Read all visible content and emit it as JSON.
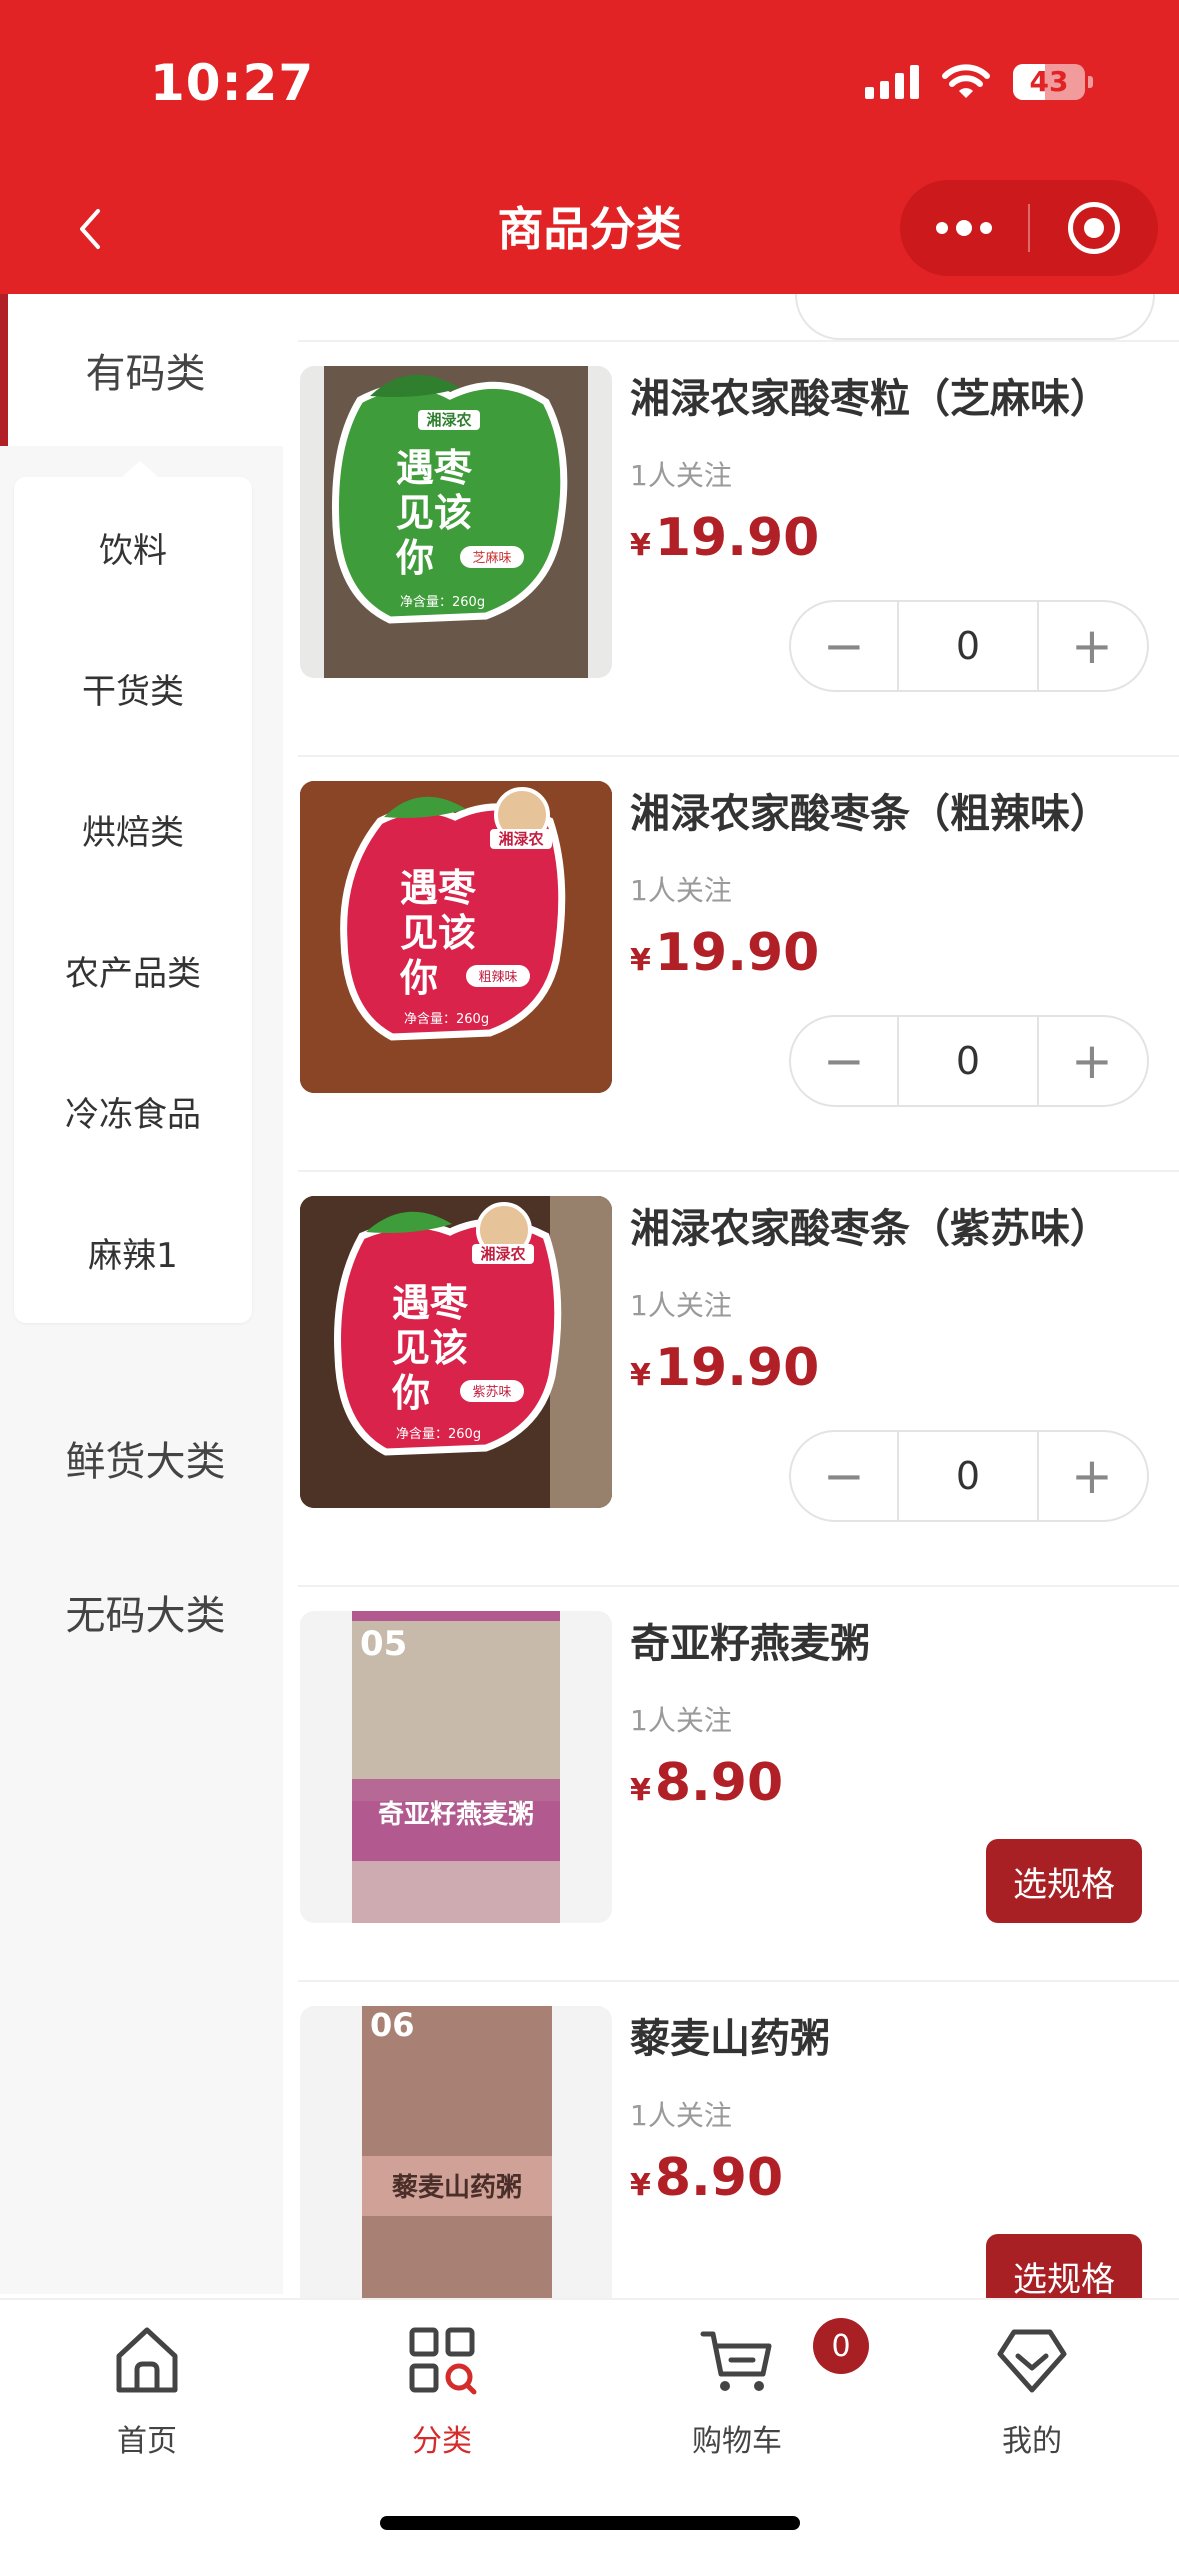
{
  "status_bar": {
    "time": "10:27",
    "battery": "43"
  },
  "header": {
    "title": "商品分类",
    "back_icon": "chevron-left-icon",
    "more_icon": "more-dots-icon",
    "close_icon": "target-close-icon"
  },
  "sidebar": {
    "active": "有码类",
    "sub_items": [
      "饮料",
      "干货类",
      "烘焙类",
      "农产品类",
      "冷冻食品",
      "麻辣1"
    ],
    "items": [
      "鲜货大类",
      "无码大类"
    ]
  },
  "products": [
    {
      "name": "湘渌农家酸枣粒（芝麻味）",
      "follow": "1人关注",
      "currency": "¥",
      "price": "19.90",
      "quantity": "0",
      "image": "酸枣粒芝麻味包装"
    },
    {
      "name": "湘渌农家酸枣条（粗辣味）",
      "follow": "1人关注",
      "currency": "¥",
      "price": "19.90",
      "quantity": "0",
      "image": "酸枣条粗辣味包装"
    },
    {
      "name": "湘渌农家酸枣条（紫苏味）",
      "follow": "1人关注",
      "currency": "¥",
      "price": "19.90",
      "quantity": "0",
      "image": "酸枣条紫苏味包装"
    },
    {
      "name": "奇亚籽燕麦粥",
      "follow": "1人关注",
      "currency": "¥",
      "price": "8.90",
      "action": "选规格",
      "image": "奇亚籽燕麦粥包装"
    },
    {
      "name": "藜麦山药粥",
      "follow": "1人关注",
      "currency": "¥",
      "price": "8.90",
      "action": "选规格",
      "image": "藜麦山药粥包装"
    }
  ],
  "package_text": {
    "brand": "湘渌农",
    "slogan_1": "遇枣",
    "slogan_2": "见该",
    "slogan_3": "你",
    "net_weight": "净含量：260g",
    "flavor_1": "芝麻味",
    "flavor_2": "粗辣味",
    "flavor_3": "紫苏味",
    "oat_title": "奇亚籽燕麦粥",
    "yam_title": "藜麦山药粥"
  },
  "tabbar": {
    "items": [
      {
        "label": "首页",
        "icon": "home-icon"
      },
      {
        "label": "分类",
        "icon": "category-icon"
      },
      {
        "label": "购物车",
        "icon": "cart-icon"
      },
      {
        "label": "我的",
        "icon": "profile-icon"
      }
    ],
    "cart_badge": "0"
  },
  "colors": {
    "brand": "#e12326",
    "price": "#b12026",
    "button": "#a81f24",
    "active_tab": "#d42b2b"
  }
}
